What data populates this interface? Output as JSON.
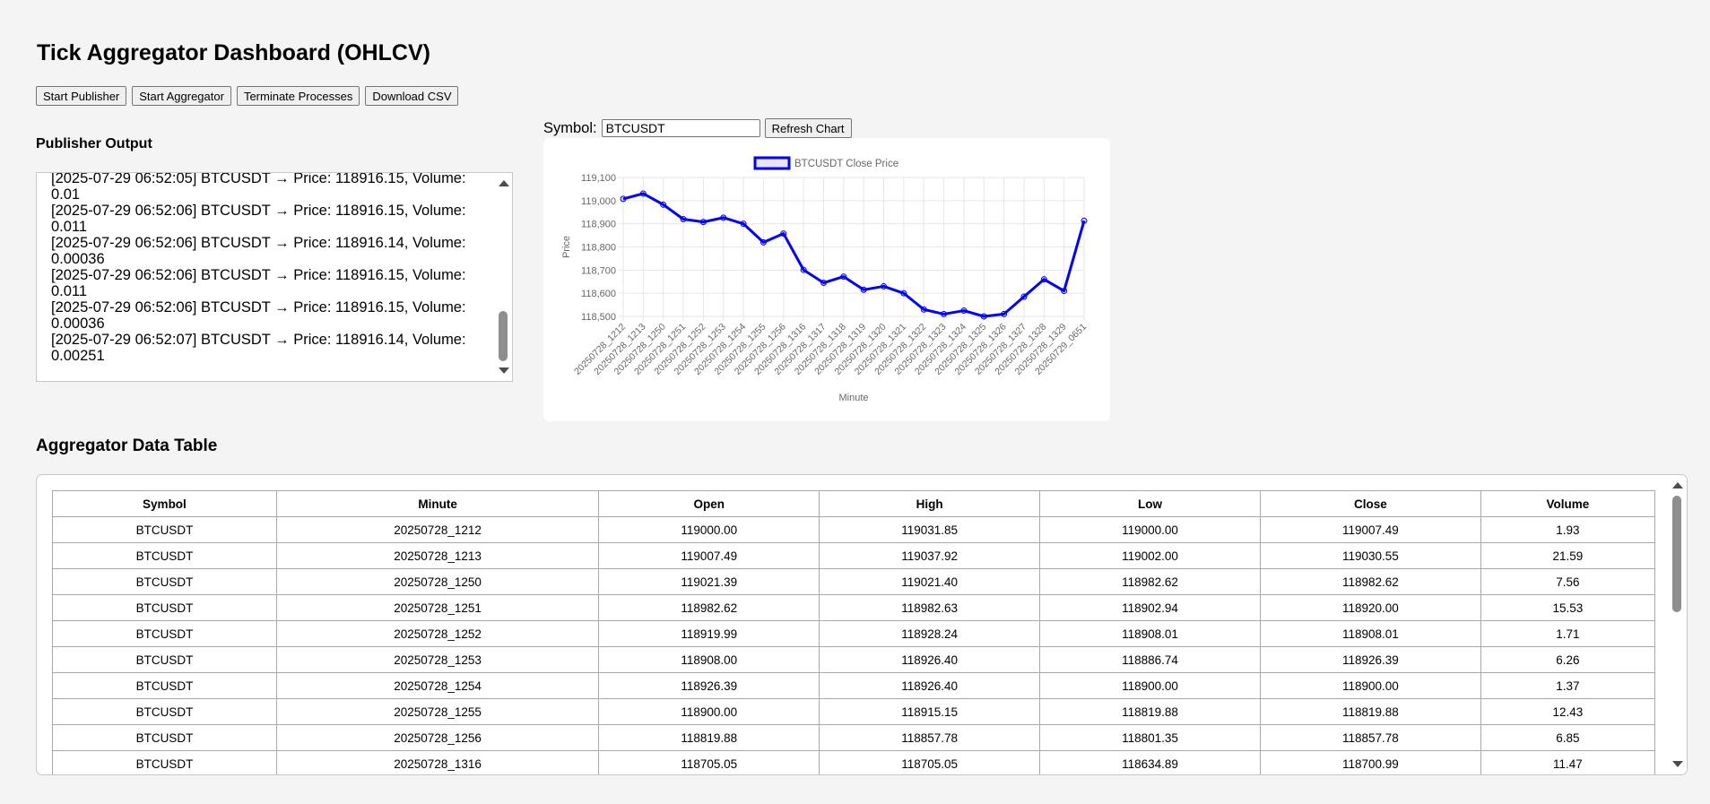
{
  "page": {
    "title": "Tick Aggregator Dashboard (OHLCV)"
  },
  "buttons": {
    "start_publisher": "Start Publisher",
    "start_aggregator": "Start Aggregator",
    "terminate": "Terminate Processes",
    "download": "Download CSV"
  },
  "publisher": {
    "title": "Publisher Output",
    "lines": [
      "[2025-07-29 06:52:05] BTCUSDT → Price: 118916.15, Volume: 0.01",
      "[2025-07-29 06:52:06] BTCUSDT → Price: 118916.15, Volume: 0.011",
      "[2025-07-29 06:52:06] BTCUSDT → Price: 118916.14, Volume: 0.00036",
      "[2025-07-29 06:52:06] BTCUSDT → Price: 118916.15, Volume: 0.011",
      "[2025-07-29 06:52:06] BTCUSDT → Price: 118916.15, Volume: 0.00036",
      "[2025-07-29 06:52:07] BTCUSDT → Price: 118916.14, Volume: 0.00251"
    ]
  },
  "symbol": {
    "label": "Symbol:",
    "value": "BTCUSDT",
    "refresh": "Refresh Chart"
  },
  "chart_data": {
    "type": "line",
    "series": [
      {
        "name": "BTCUSDT Close Price",
        "color": "#0000ff",
        "values": [
          119007.49,
          119030.55,
          118982.62,
          118920.0,
          118908.01,
          118926.39,
          118900.0,
          118819.88,
          118857.78,
          118700.99,
          118645,
          118672,
          118615,
          118630,
          118600,
          118530,
          118510,
          118525,
          118500,
          118510,
          118585,
          118660,
          118610,
          118913
        ]
      }
    ],
    "categories": [
      "20250728_1212",
      "20250728_1213",
      "20250728_1250",
      "20250728_1251",
      "20250728_1252",
      "20250728_1253",
      "20250728_1254",
      "20250728_1255",
      "20250728_1256",
      "20250728_1316",
      "20250728_1317",
      "20250728_1318",
      "20250728_1319",
      "20250728_1320",
      "20250728_1321",
      "20250728_1322",
      "20250728_1323",
      "20250728_1324",
      "20250728_1325",
      "20250728_1326",
      "20250728_1327",
      "20250728_1328",
      "20250728_1329",
      "20250729_0651"
    ],
    "xlabel": "Minute",
    "ylabel": "Price",
    "ylim": [
      118500,
      119100
    ],
    "yticks": [
      "119,100",
      "119,000",
      "118,900",
      "118,800",
      "118,700",
      "118,600",
      "118,500"
    ],
    "grid": true,
    "legend": "top"
  },
  "aggregator": {
    "title": "Aggregator Data Table",
    "columns": [
      "Symbol",
      "Minute",
      "Open",
      "High",
      "Low",
      "Close",
      "Volume"
    ],
    "rows": [
      [
        "BTCUSDT",
        "20250728_1212",
        "119000.00",
        "119031.85",
        "119000.00",
        "119007.49",
        "1.93"
      ],
      [
        "BTCUSDT",
        "20250728_1213",
        "119007.49",
        "119037.92",
        "119002.00",
        "119030.55",
        "21.59"
      ],
      [
        "BTCUSDT",
        "20250728_1250",
        "119021.39",
        "119021.40",
        "118982.62",
        "118982.62",
        "7.56"
      ],
      [
        "BTCUSDT",
        "20250728_1251",
        "118982.62",
        "118982.63",
        "118902.94",
        "118920.00",
        "15.53"
      ],
      [
        "BTCUSDT",
        "20250728_1252",
        "118919.99",
        "118928.24",
        "118908.01",
        "118908.01",
        "1.71"
      ],
      [
        "BTCUSDT",
        "20250728_1253",
        "118908.00",
        "118926.40",
        "118886.74",
        "118926.39",
        "6.26"
      ],
      [
        "BTCUSDT",
        "20250728_1254",
        "118926.39",
        "118926.40",
        "118900.00",
        "118900.00",
        "1.37"
      ],
      [
        "BTCUSDT",
        "20250728_1255",
        "118900.00",
        "118915.15",
        "118819.88",
        "118819.88",
        "12.43"
      ],
      [
        "BTCUSDT",
        "20250728_1256",
        "118819.88",
        "118857.78",
        "118801.35",
        "118857.78",
        "6.85"
      ],
      [
        "BTCUSDT",
        "20250728_1316",
        "118705.05",
        "118705.05",
        "118634.89",
        "118700.99",
        "11.47"
      ]
    ]
  }
}
